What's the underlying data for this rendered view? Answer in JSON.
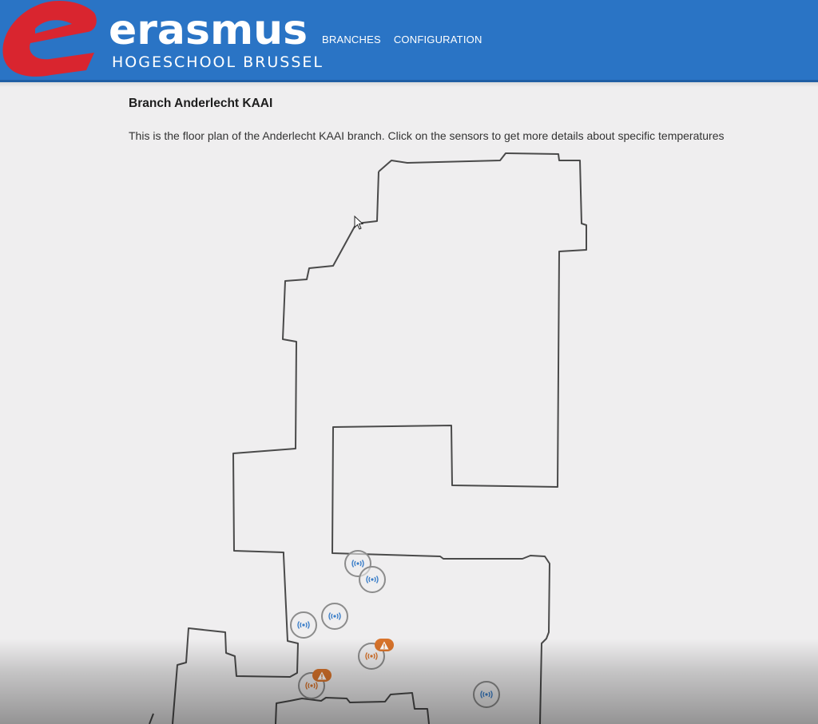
{
  "header": {
    "brand_word": "erasmus",
    "brand_sub": "HOGESCHOOL  BRUSSEL",
    "nav": [
      {
        "label": "BRANCHES"
      },
      {
        "label": "CONFIGURATION"
      }
    ]
  },
  "main": {
    "title": "Branch Anderlecht KAAI",
    "description": "This is the floor plan of the Anderlecht KAAI branch. Click on the sensors to get more details about specific temperatures"
  },
  "sensors": [
    {
      "status": "normal"
    },
    {
      "status": "normal"
    },
    {
      "status": "normal"
    },
    {
      "status": "normal"
    },
    {
      "status": "warning"
    },
    {
      "status": "warning"
    },
    {
      "status": "normal"
    }
  ],
  "colors": {
    "header_bg": "#2a74c5",
    "logo_red": "#d9252f",
    "sensor_normal": "#3c7fc9",
    "sensor_warning": "#d9742b",
    "warning_badge": "#d9742b"
  },
  "icons": {
    "sensor": "wireless-signal-icon",
    "warning": "warning-triangle-icon",
    "cursor": "mouse-pointer-icon"
  }
}
